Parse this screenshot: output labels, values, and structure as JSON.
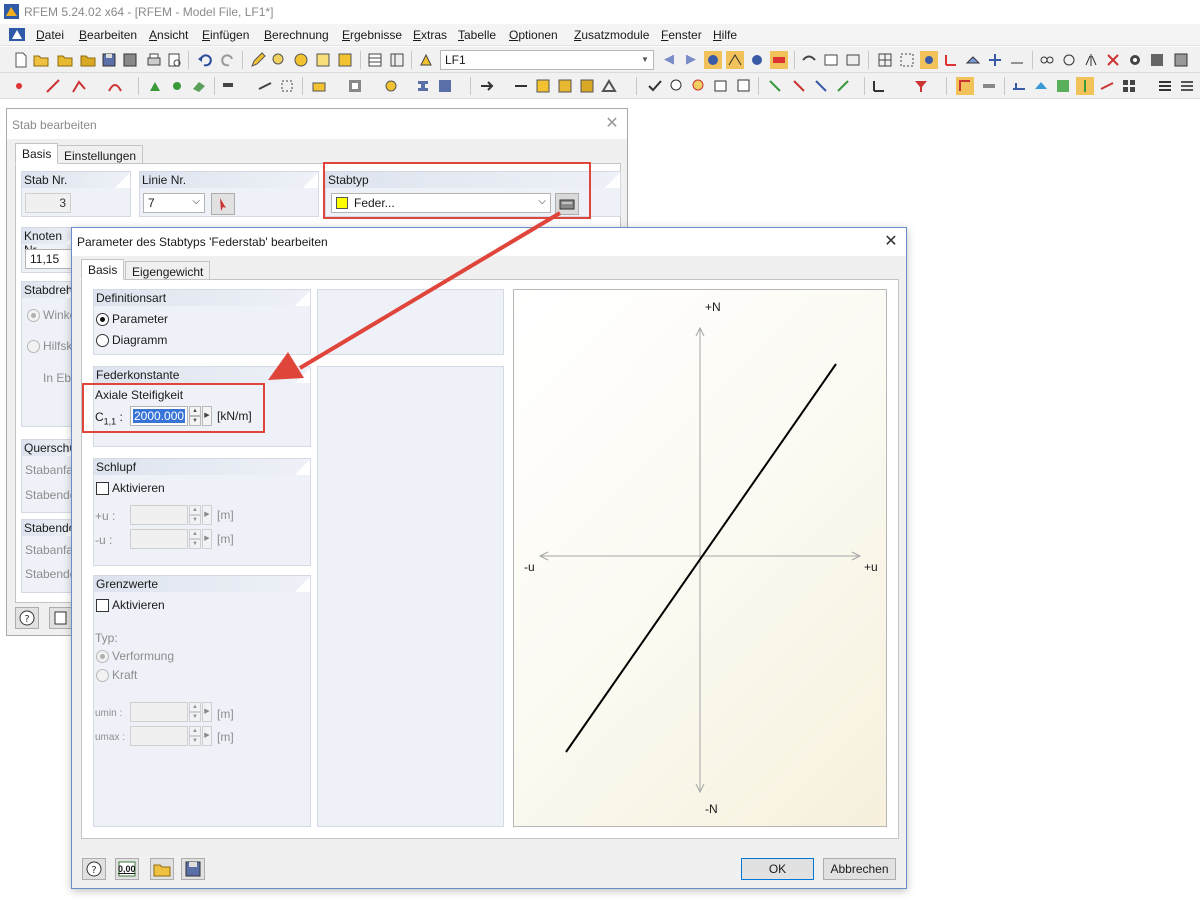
{
  "app": {
    "title": "RFEM 5.24.02 x64 - [RFEM - Model File, LF1*]"
  },
  "menu": [
    "Datei",
    "Bearbeiten",
    "Ansicht",
    "Einfügen",
    "Berechnung",
    "Ergebnisse",
    "Extras",
    "Tabelle",
    "Optionen",
    "Zusatzmodule",
    "Fenster",
    "Hilfe"
  ],
  "toolbar": {
    "loadcase": "LF1"
  },
  "stab_dialog": {
    "title": "Stab bearbeiten",
    "tabs": [
      "Basis",
      "Einstellungen"
    ],
    "stab_nr_label": "Stab Nr.",
    "stab_nr_value": "3",
    "linie_nr_label": "Linie Nr.",
    "linie_nr_value": "7",
    "stabtyp_label": "Stabtyp",
    "stabtyp_value": "Feder...",
    "stabtyp_color": "#ffff00",
    "knoten_label": "Knoten Nr.",
    "knoten_value": "11,15",
    "stabdrehung_label": "Stabdrehung",
    "winkel_label": "Winkel",
    "hilfsknoten_label": "Hilfsknoten",
    "in_ebene_label": "In Ebene",
    "querschnitt_label": "Querschnitt",
    "stabanfang_label": "Stabanfang",
    "stabende_label": "Stabende",
    "stabendgelenk_label": "Stabendgelenk",
    "stabanfang2_label": "Stabanfang",
    "stabende2_label": "Stabende"
  },
  "federstab_dialog": {
    "title": "Parameter des Stabtyps 'Federstab' bearbeiten",
    "tabs": [
      "Basis",
      "Eigengewicht"
    ],
    "definitionsart": {
      "title": "Definitionsart",
      "parameter": "Parameter",
      "diagramm": "Diagramm",
      "selected": "Parameter"
    },
    "federkonstante": {
      "title": "Federkonstante",
      "axial_label": "Axiale Steifigkeit",
      "c_label": "C",
      "c_sub": "1,1",
      "c_colon": ":",
      "value": "2000.000",
      "unit": "[kN/m]"
    },
    "schlupf": {
      "title": "Schlupf",
      "aktivieren": "Aktivieren",
      "plus_u": "+u :",
      "minus_u": "-u :",
      "unit": "[m]"
    },
    "grenzwerte": {
      "title": "Grenzwerte",
      "aktivieren": "Aktivieren",
      "typ": "Typ:",
      "verformung": "Verformung",
      "kraft": "Kraft",
      "umin": "umin :",
      "umax": "umax :",
      "unit": "[m]"
    },
    "diagram": {
      "plus_n": "+N",
      "minus_n": "-N",
      "minus_u": "-u",
      "plus_u": "+u",
      "line_color": "#000000"
    },
    "buttons": {
      "ok": "OK",
      "cancel": "Abbrechen",
      "units_label": "0,00"
    }
  },
  "annotation": {
    "highlight_color": "#e0453c"
  }
}
